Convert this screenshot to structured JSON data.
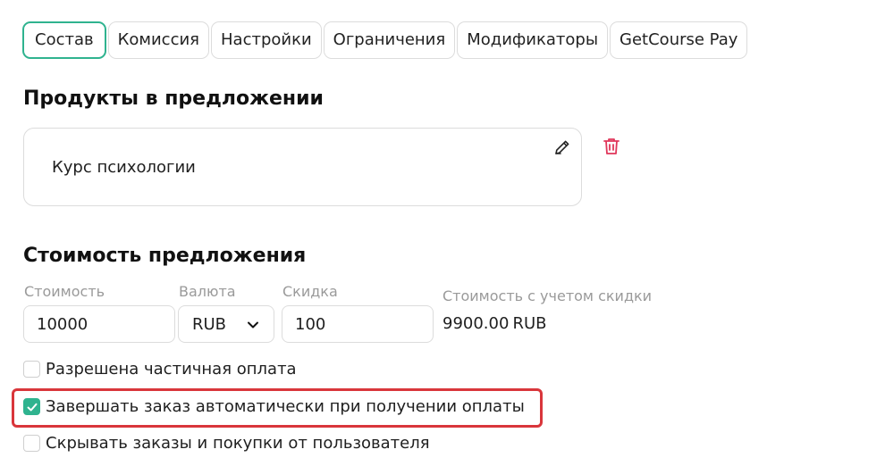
{
  "tabs": [
    {
      "label": "Состав",
      "active": true
    },
    {
      "label": "Комиссия",
      "active": false
    },
    {
      "label": "Настройки",
      "active": false
    },
    {
      "label": "Ограничения",
      "active": false
    },
    {
      "label": "Модификаторы",
      "active": false
    },
    {
      "label": "GetCourse Pay",
      "active": false
    }
  ],
  "products": {
    "title": "Продукты в предложении",
    "items": [
      {
        "name": "Курс психологии"
      }
    ]
  },
  "pricing": {
    "title": "Стоимость предложения",
    "price_label": "Стоимость",
    "price_value": "10000",
    "currency_label": "Валюта",
    "currency_value": "RUB",
    "discount_label": "Скидка",
    "discount_value": "100",
    "total_label": "Стоимость с учетом скидки",
    "total_amount": "9900.00",
    "total_currency": "RUB"
  },
  "options": [
    {
      "label": "Разрешена частичная оплата",
      "checked": false
    },
    {
      "label": "Завершать заказ автоматически при получении оплаты",
      "checked": true
    },
    {
      "label": "Скрывать заказы и покупки от пользователя",
      "checked": false
    }
  ],
  "colors": {
    "accent": "#2fb38f",
    "highlight": "#d9363b",
    "delete_icon": "#e0365a"
  },
  "icons": {
    "edit": "pencil-icon",
    "delete": "trash-icon",
    "select_arrow": "chevron-down-icon",
    "check": "checkmark-icon"
  }
}
